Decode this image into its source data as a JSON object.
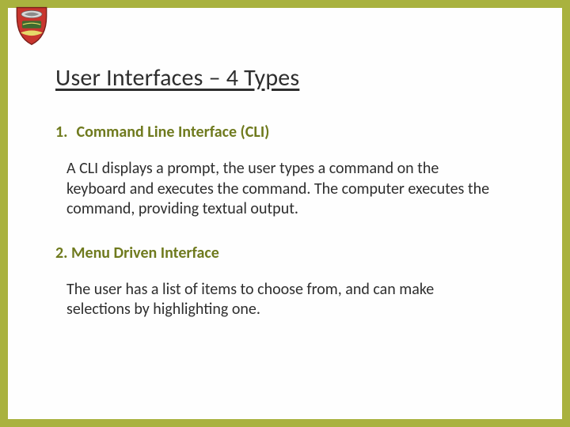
{
  "title": "User Interfaces – 4 Types",
  "section1": {
    "num": "1.",
    "heading": "Command Line Interface (CLI)",
    "body": "A CLI displays a prompt, the user types a command on the keyboard and executes the command. The computer executes the command, providing textual output."
  },
  "section2": {
    "num": "2.",
    "heading": "Menu Driven Interface",
    "body": "The user has a list of items to choose from, and can make selections by highlighting one."
  }
}
